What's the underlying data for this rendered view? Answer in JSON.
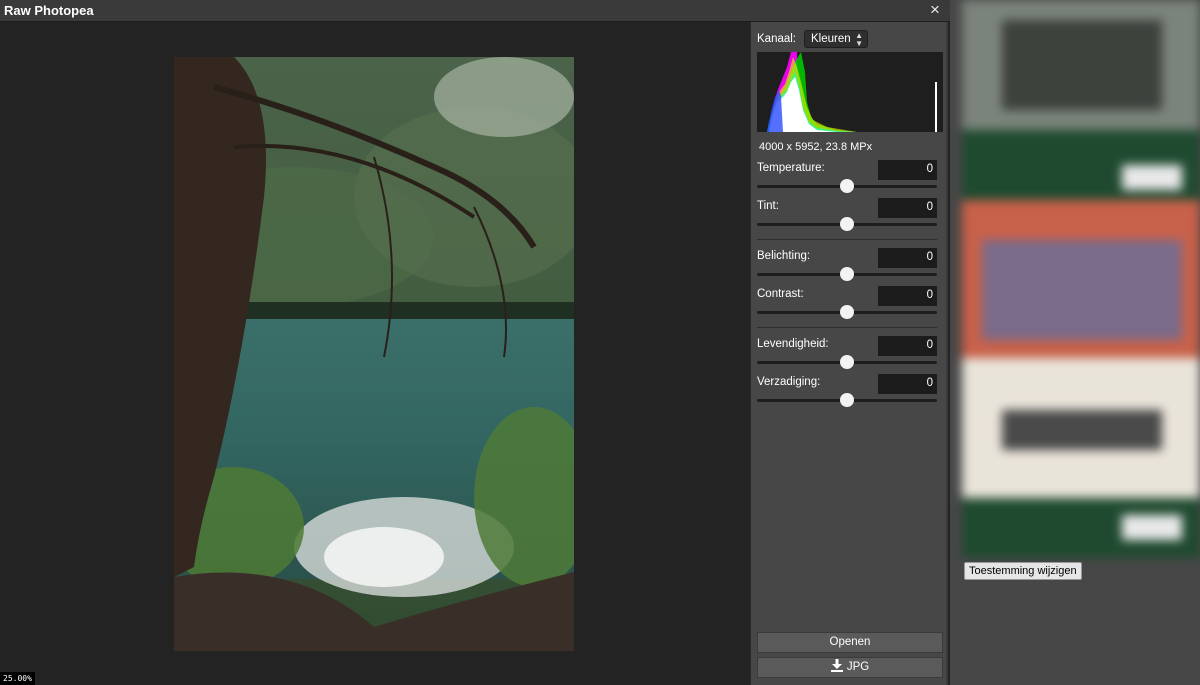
{
  "window": {
    "title": "Raw Photopea",
    "close_glyph": "×"
  },
  "viewport": {
    "zoom": "25.00%"
  },
  "panel": {
    "channel_label": "Kanaal:",
    "channel_value": "Kleuren",
    "image_info": "4000 x 5952, 23.8 MPx",
    "controls": [
      {
        "label": "Temperature:",
        "value": "0",
        "level": 0.5
      },
      {
        "label": "Tint:",
        "value": "0",
        "level": 0.5
      },
      {
        "label": "Belichting:",
        "value": "0",
        "level": 0.5
      },
      {
        "label": "Contrast:",
        "value": "0",
        "level": 0.5
      },
      {
        "label": "Levendigheid:",
        "value": "0",
        "level": 0.5
      },
      {
        "label": "Verzadiging:",
        "value": "0",
        "level": 0.5
      }
    ],
    "open_label": "Openen",
    "jpg_label": "JPG"
  },
  "sidebar": {
    "consent_label": "Toestemming wijzigen"
  },
  "icons": {
    "close": "close-icon",
    "download": "download-icon",
    "select": "updown-arrows-icon"
  }
}
